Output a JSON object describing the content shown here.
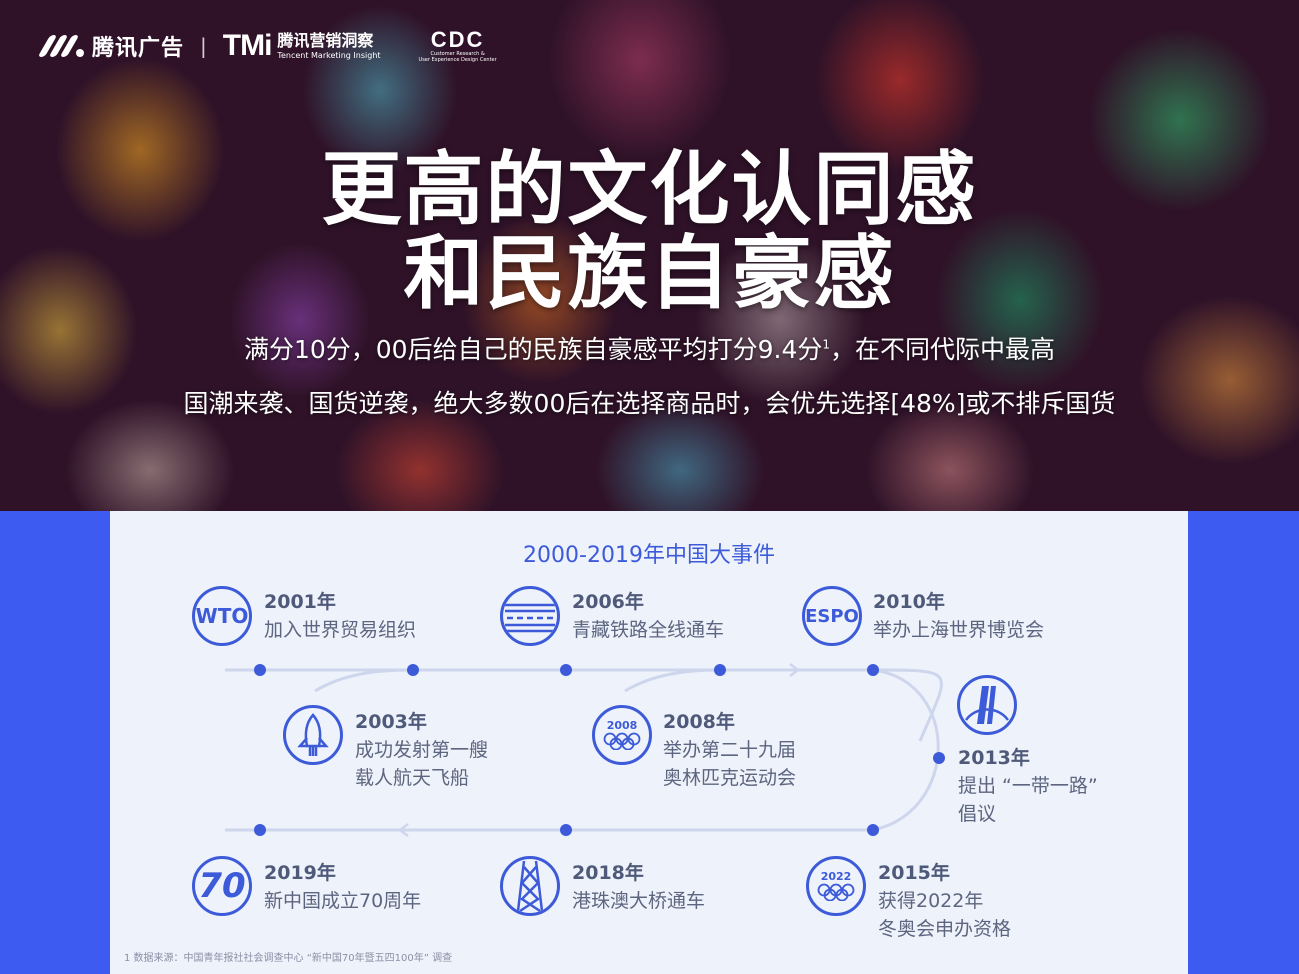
{
  "header": {
    "brand1": "腾讯广告",
    "separator": "|",
    "tmi_logo": "TMi",
    "tmi_cn": "腾讯营销洞察",
    "tmi_en": "Tencent Marketing Insight",
    "cdc_logo": "CDC",
    "cdc_sub1": "Customer Research &",
    "cdc_sub2": "User Experience Design Center"
  },
  "hero": {
    "title_line1": "更高的文化认同感",
    "title_line2": "和民族自豪感",
    "sub1_main": "满分10分，00后给自己的民族自豪感平均打分9.4分",
    "sub1_sup": "1",
    "sub1_tail": "，在不同代际中最高",
    "sub2": "国潮来袭、国货逆袭，绝大多数00后在选择商品时，会优先选择[48%]或不排斥国货"
  },
  "timeline": {
    "title": "2000-2019年中国大事件",
    "events": [
      {
        "year": "2001年",
        "desc": "加入世界贸易组织",
        "icon": "wto-icon",
        "icon_text": "WTO"
      },
      {
        "year": "2006年",
        "desc": "青藏铁路全线通车",
        "icon": "railway-icon"
      },
      {
        "year": "2010年",
        "desc": "举办上海世界博览会",
        "icon": "expo-icon",
        "icon_text": "ESPO"
      },
      {
        "year": "2003年",
        "desc": "成功发射第一艘\n载人航天飞船",
        "icon": "rocket-icon"
      },
      {
        "year": "2008年",
        "desc": "举办第二十九届\n奥林匹克运动会",
        "icon": "olympics-2008-icon",
        "icon_text": "2008"
      },
      {
        "year": "2013年",
        "desc": "提出 “一带一路”\n倡议",
        "icon": "belt-road-icon"
      },
      {
        "year": "2019年",
        "desc": "新中国成立70周年",
        "icon": "seventy-icon",
        "icon_text": "70"
      },
      {
        "year": "2018年",
        "desc": "港珠澳大桥通车",
        "icon": "bridge-icon"
      },
      {
        "year": "2015年",
        "desc": "获得2022年\n冬奥会申办资格",
        "icon": "olympics-2022-icon",
        "icon_text": "2022"
      }
    ]
  },
  "footnote": "1 数据来源：中国青年报社社会调查中心 “新中国70年暨五四100年” 调查",
  "colors": {
    "accent": "#3d5bd9",
    "side": "#3d5bf0",
    "panel": "#eef2fa"
  }
}
